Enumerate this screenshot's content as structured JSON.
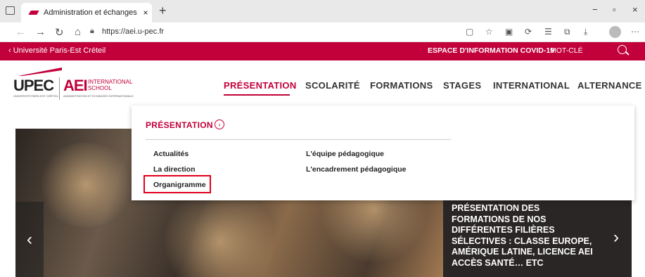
{
  "browser": {
    "tab_title": "Administration et échanges inte",
    "tab_close": "×",
    "new_tab": "+",
    "url": "https://aei.u-pec.fr",
    "win_min": "−",
    "win_max": "▫",
    "win_close": "×"
  },
  "topstrip": {
    "back_link": "‹ Université Paris-Est Créteil",
    "covid": "ESPACE D'INFORMATION COVID-19",
    "motcle": "MOT-CLÉ"
  },
  "logo": {
    "upec": "UPEC",
    "upec_sub": "UNIVERSITÉ PARIS-EST CRÉTEIL",
    "aei": "AEI",
    "intl_line1": "INTERNATIONAL",
    "intl_line2": "SCHOOL",
    "aei_sub": "ADMINISTRATION ET ÉCHANGES INTERNATIONAUX"
  },
  "mainnav": [
    {
      "label": "PRÉSENTATION"
    },
    {
      "label": "SCOLARITÉ"
    },
    {
      "label": "FORMATIONS"
    },
    {
      "label": "STAGES"
    },
    {
      "label": "INTERNATIONAL"
    },
    {
      "label": "ALTERNANCE"
    }
  ],
  "dropdown": {
    "title": "PRÉSENTATION",
    "col1": [
      "Actualités",
      "La direction",
      "Organigramme"
    ],
    "col2": [
      "L'équipe pédagogique",
      "L'encadrement pédagogique"
    ]
  },
  "hero": {
    "caption": "PRÉSENTATION DES FORMATIONS DE NOS DIFFÉRENTES FILIÈRES SÉLECTIVES : CLASSE EUROPE, AMÉRIQUE LATINE, LICENCE AEI ACCÈS SANTÉ… ETC",
    "prev": "‹",
    "next": "›"
  },
  "colors": {
    "brand": "#c2003a",
    "highlight": "#e0001b"
  }
}
